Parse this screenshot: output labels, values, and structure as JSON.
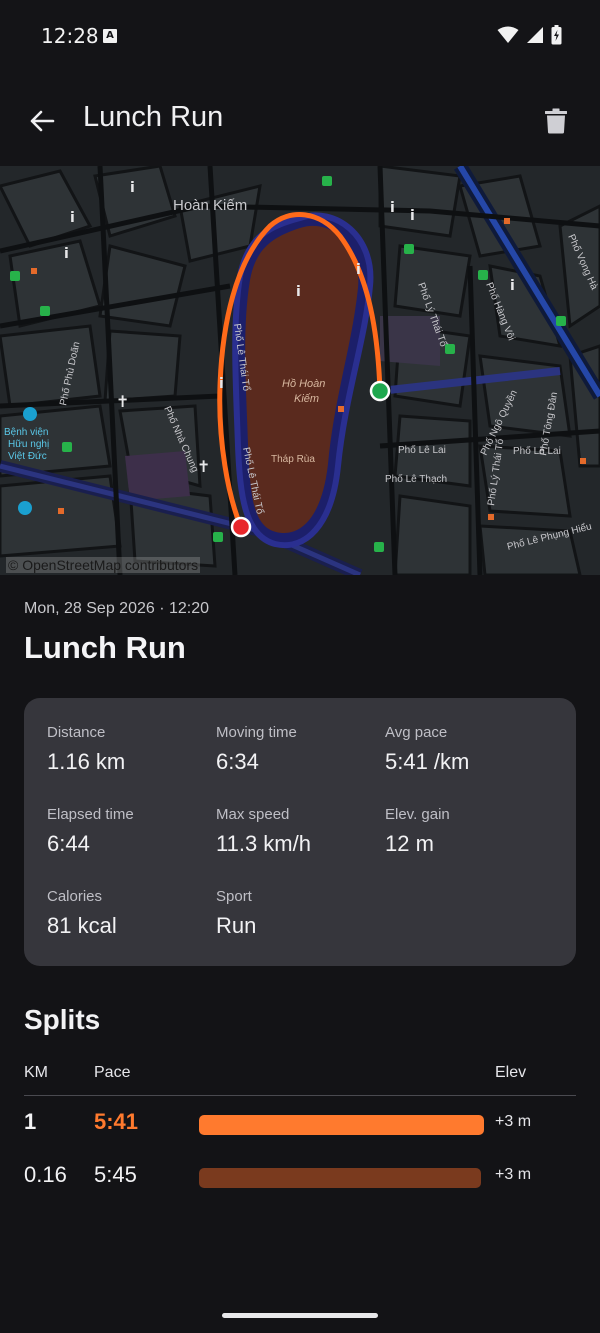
{
  "status": {
    "time": "12:28",
    "badge": "A"
  },
  "app_bar": {
    "title": "Lunch Run"
  },
  "map": {
    "attribution": "© OpenStreetMap contributors",
    "labels": {
      "district": "Hoàn Kiếm",
      "lake_1": "Hồ Hoàn",
      "lake_2": "Kiếm",
      "tower": "Tháp Rùa",
      "street_1": "Phố Lê Thái Tổ",
      "street_2": "Phố Lê Thái Tổ",
      "street_3": "Phố Lê Lai",
      "street_4": "Phố Lê Thạch",
      "street_5": "Phố Lý Thái Tổ",
      "street_6": "Phố Hàng Vôi",
      "street_7": "Phố Nhà Chung",
      "street_8": "Phố Phủ Doãn",
      "street_9": "Phố Vọng Hà",
      "street_10": "Phố Ngô Quyền",
      "street_11": "Phố Lê Lai",
      "street_12": "Phố Tông Đản",
      "street_13": "Phố Lê Phụng Hiểu",
      "street_14": "Phố Lý Thái Tổ",
      "hospital_1": "Bệnh viện",
      "hospital_2": "Hữu nghị",
      "hospital_3": "Việt Đức"
    },
    "route_color": "#ff6a1a",
    "start_color": "#1fa84f",
    "end_color": "#e8262a"
  },
  "activity": {
    "date": "Mon, 28 Sep 2026 · 12:20",
    "title": "Lunch Run"
  },
  "stats": [
    {
      "label": "Distance",
      "value": "1.16 km"
    },
    {
      "label": "Moving time",
      "value": "6:34"
    },
    {
      "label": "Avg pace",
      "value": "5:41 /km"
    },
    {
      "label": "Elapsed time",
      "value": "6:44"
    },
    {
      "label": "Max speed",
      "value": "11.3 km/h"
    },
    {
      "label": "Elev. gain",
      "value": "12 m"
    },
    {
      "label": "Calories",
      "value": "81 kcal"
    },
    {
      "label": "Sport",
      "value": "Run"
    }
  ],
  "splits": {
    "title": "Splits",
    "headers": {
      "km": "KM",
      "pace": "Pace",
      "elev": "Elev"
    },
    "rows": [
      {
        "km": "1",
        "pace": "5:41",
        "elev": "+3 m",
        "relative_pace": 1.0,
        "highlight": true
      },
      {
        "km": "0.16",
        "pace": "5:45",
        "elev": "+3 m",
        "relative_pace": 0.99,
        "highlight": false
      }
    ]
  },
  "colors": {
    "accent": "#ff7a2e",
    "bar_best": "#ff7a2e",
    "bar_other": "#7a3a1e"
  }
}
